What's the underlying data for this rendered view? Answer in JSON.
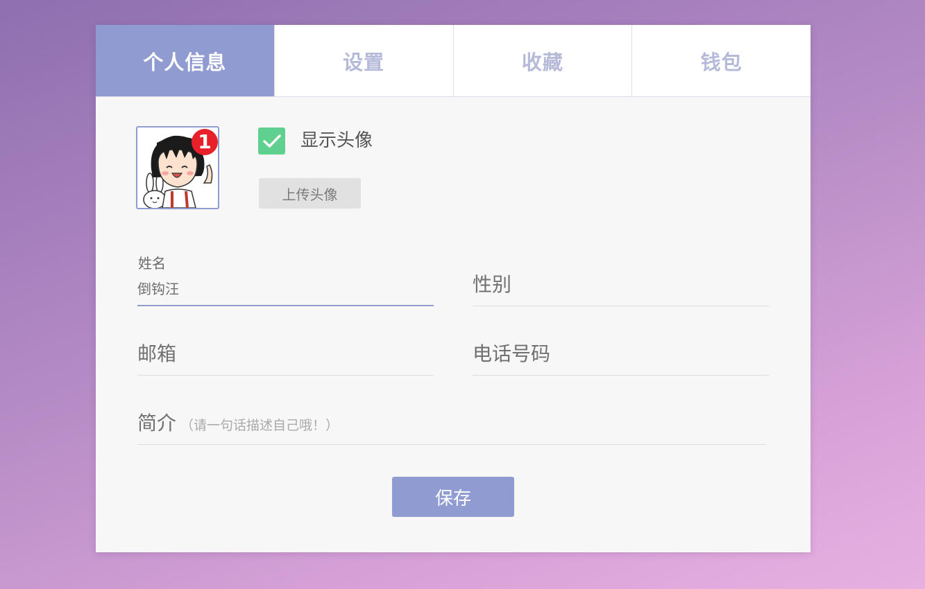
{
  "tabs": [
    {
      "label": "个人信息",
      "active": true
    },
    {
      "label": "设置",
      "active": false
    },
    {
      "label": "收藏",
      "active": false
    },
    {
      "label": "钱包",
      "active": false
    }
  ],
  "avatar": {
    "badge_count": "1",
    "icon": "cartoon-avatar"
  },
  "show_avatar": {
    "checked": true,
    "label": "显示头像"
  },
  "upload_button": "上传头像",
  "form": {
    "name": {
      "label": "姓名",
      "value": "倒钩汪"
    },
    "gender": {
      "placeholder": "性别"
    },
    "email": {
      "placeholder": "邮箱"
    },
    "phone": {
      "placeholder": "电话号码"
    },
    "bio": {
      "placeholder": "简介",
      "hint": "（请一句话描述自己哦！）"
    }
  },
  "save_button": "保存",
  "colors": {
    "accent": "#8f9bd1",
    "checkbox": "#5fd08e",
    "badge": "#e8202a",
    "tab_inactive_text": "#b6bad9"
  }
}
